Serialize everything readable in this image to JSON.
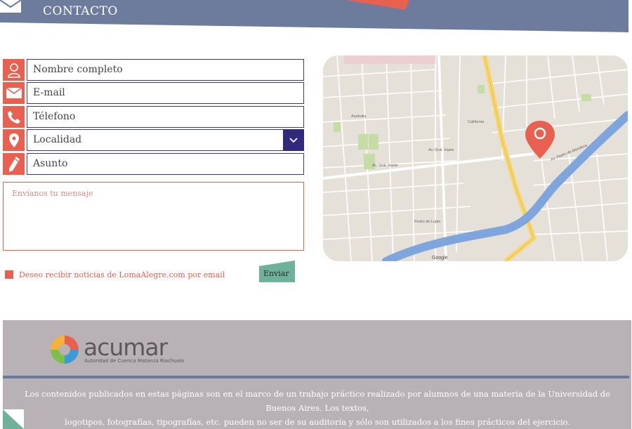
{
  "header": {
    "title": "CONTACTO",
    "icon": "envelope-icon",
    "colors": {
      "band": "#6d7b9d",
      "accent": "#e8604f"
    }
  },
  "form": {
    "fields": [
      {
        "icon": "user-icon",
        "placeholder": "Nombre completo"
      },
      {
        "icon": "envelope-icon",
        "placeholder": "E-mail"
      },
      {
        "icon": "phone-icon",
        "placeholder": "Télefono"
      },
      {
        "icon": "location-pin-icon",
        "placeholder": "Localidad"
      },
      {
        "icon": "pencil-icon",
        "placeholder": "Asunto"
      }
    ],
    "message_placeholder": "Envíanos tu mensaje",
    "newsletter_label": "Deseo recibir noticias de LomaAlegre.com por email",
    "send_label": "Enviar",
    "colors": {
      "icon_bg": "#e8604f",
      "border": "#3d3b7d",
      "send_bg": "#6fb29c"
    }
  },
  "map": {
    "provider": "Google",
    "streets": [
      "Av. Gral. Iriarte",
      "California",
      "Australia",
      "Av. Pedro de Mendoza",
      "Gral. Gregorio Aráoz de Lamadrid",
      "Pedro de Luján"
    ],
    "marker": "map-pin-icon"
  },
  "footer": {
    "logo_word": "acumar",
    "logo_sub": "Autoridad de Cuenca Matanza Riachuelo",
    "disclaimer_line1": "Los contenidos publicados en estas páginas son en el marco de un trabajo práctico realizado por alumnos de una materia de la Universidad de Buenos Aires. Los textos,",
    "disclaimer_line2": "logotipos, fotografías, tipografías, etc. pueden no ser de su auditoría y sólo son utilizados a los fines prácticos del ejercicio."
  }
}
